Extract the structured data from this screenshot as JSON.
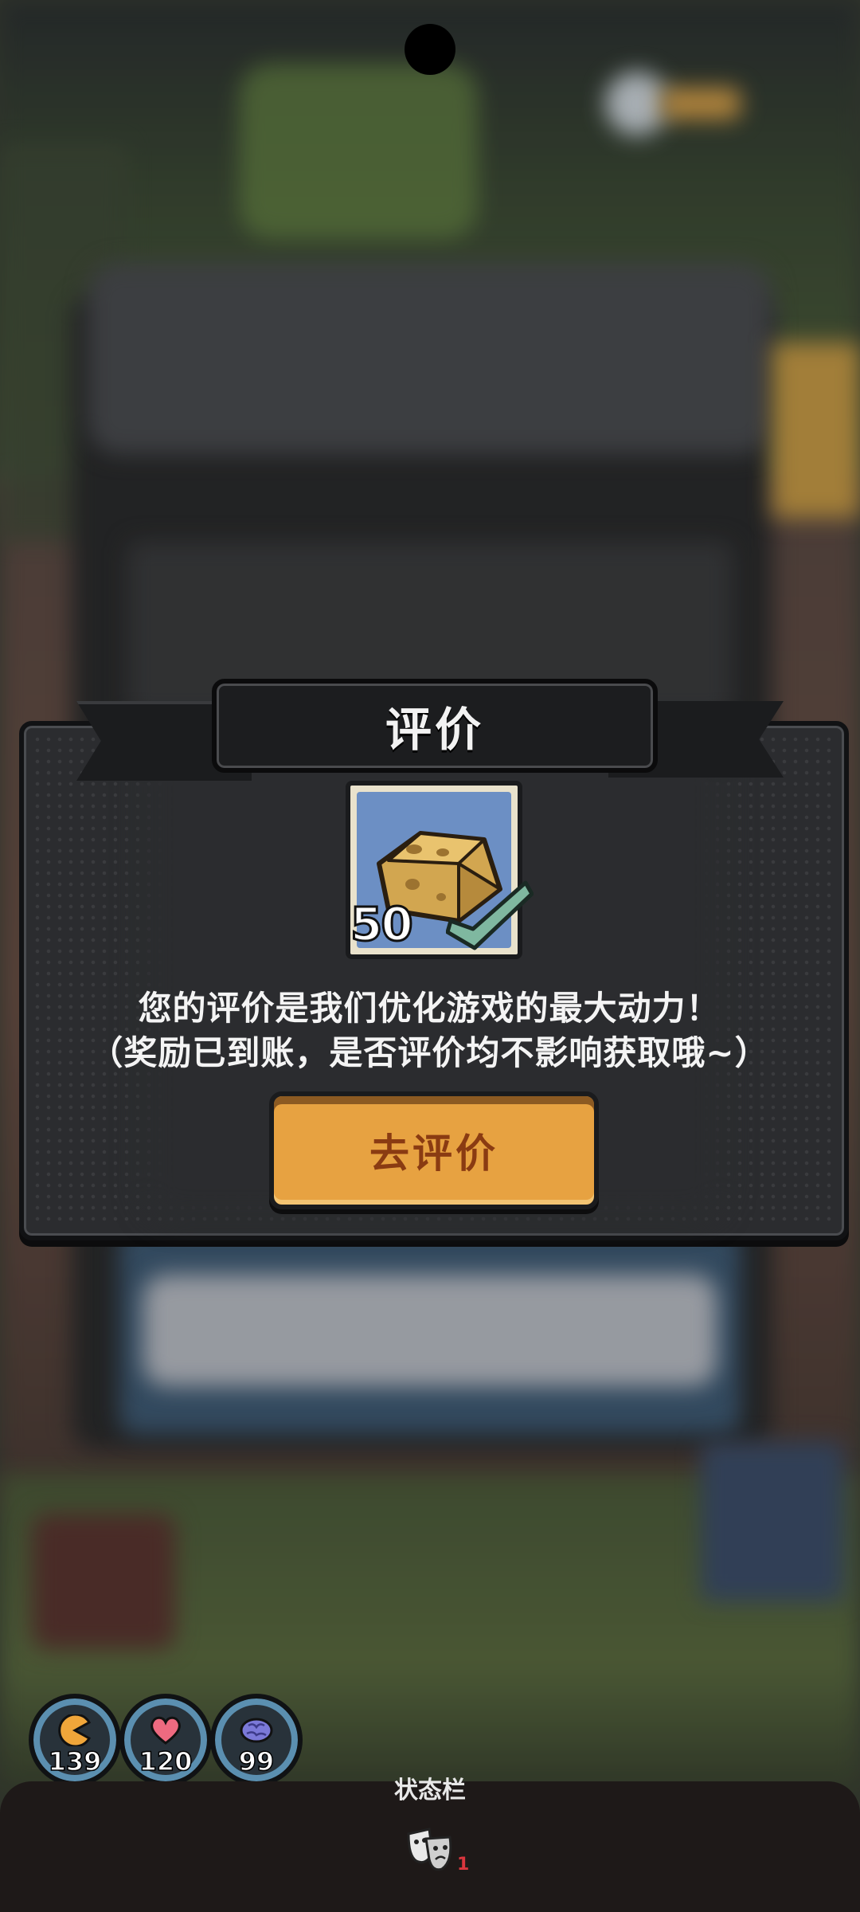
{
  "dialog": {
    "title": "评价",
    "reward": {
      "quantity": "50",
      "claimed": true
    },
    "message_line1": "您的评价是我们优化游戏的最大动力！",
    "message_line2": "（奖励已到账，是否评价均不影响获取哦~）",
    "button_label": "去评价"
  },
  "stats": [
    {
      "icon": "hunger-icon",
      "value": "139"
    },
    {
      "icon": "heart-icon",
      "value": "120"
    },
    {
      "icon": "brain-icon",
      "value": "99"
    }
  ],
  "bottom_bar": {
    "title": "状态栏",
    "masks_count": "1"
  },
  "colors": {
    "button": "#e7a241",
    "panel": "#2b2c2f",
    "stat_ring": "#5b8fb0"
  }
}
